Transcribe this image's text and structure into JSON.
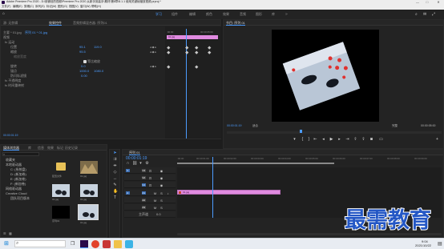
{
  "app": {
    "title": "Adobe Premiere Pro 2020 - D:\\用微信的视频\\Premiere Pro 2020 从新手到高手\\素材\\第8章\\8.1.1 使用关键帧缩放视频.prproj *"
  },
  "menu": [
    "文件(F)",
    "编辑(E)",
    "剪辑(C)",
    "序列(S)",
    "标记(M)",
    "图形(G)",
    "视图(V)",
    "窗口(W)",
    "帮助(H)"
  ],
  "workspace_tabs": [
    "学习",
    "组件",
    "编辑",
    "颜色",
    "效果",
    "音频",
    "图形",
    "库"
  ],
  "workspace_active": "学习",
  "source_panel": {
    "tabs": [
      "源: 无剪辑",
      "效果控件",
      "音频剪辑混合器: 序列01"
    ],
    "master_label": "主要 * 01.jpg",
    "clip_label": "序列 01 * 01.jpg",
    "time_in": ":00:00",
    "time_out": "00:00:05:00",
    "clip_name": "01.jpg",
    "sections": {
      "video": "视频",
      "motion": "fx 运动",
      "position": "位置",
      "position_x": "95.1",
      "position_y": "119.0",
      "scale": "缩放",
      "scale_value": "95.5",
      "scale_width": "缩放宽度",
      "uniform_scale": "等比缩放",
      "rotation": "旋转",
      "rotation_value": "0.0",
      "anchor": "锚点",
      "anchor_x": "1000.0",
      "anchor_y": "1080.0",
      "flicker": "防闪烁滤镜",
      "flicker_value": "0.00",
      "opacity": "fx 不透明度",
      "time_remap": "fx 时间重映射"
    },
    "timecode": "00:00:01:19"
  },
  "program_panel": {
    "title": "节目: 序列 01",
    "timecode": "00:00:01:19",
    "fit": "适合",
    "quality": "完整",
    "duration": "00:00:05:00"
  },
  "project_panel": {
    "tabs": [
      "项目: 使用关键帧缩放视频",
      "媒体浏览器",
      "库",
      "信息",
      "效果",
      "标记",
      "历史记录"
    ],
    "search_placeholder": "",
    "tree": [
      {
        "label": "收藏夹",
        "indent": 0
      },
      {
        "label": "本地驱动器",
        "indent": 0
      },
      {
        "label": "C: (系统盘)",
        "indent": 1
      },
      {
        "label": "D: (新加卷)",
        "indent": 1
      },
      {
        "label": "E: (新加卷)",
        "indent": 1
      },
      {
        "label": "F: (新加卷)",
        "indent": 1
      },
      {
        "label": "网络驱动器",
        "indent": 0
      },
      {
        "label": "Creative Cloud",
        "indent": 0
      },
      {
        "label": "团队项目版本",
        "indent": 1
      }
    ],
    "items": [
      {
        "label": "配置文件",
        "kind": "folder"
      },
      {
        "label": "01.jpg",
        "kind": "photo"
      },
      {
        "label": "01.jpg",
        "kind": "photo"
      },
      {
        "label": "01.jpg",
        "kind": "photo"
      },
      {
        "label": "序列01",
        "kind": "black"
      },
      {
        "label": "01.jpg",
        "kind": "photo"
      }
    ]
  },
  "timeline": {
    "title": "序列 01",
    "timecode": "00:00:01:19",
    "ruler": [
      ":00:00",
      "00:00:01:00",
      "00:00:02:00",
      "00:00:03:00",
      "00:00:04:00",
      "00:00:05:00",
      "00:00:06:00",
      "00:00:07:00",
      "00:00:08:00",
      "00:00:09:00"
    ],
    "tracks": [
      "V3",
      "V2",
      "V1",
      "A1",
      "A2",
      "A3"
    ],
    "master": "主声道",
    "master_value": "0.0",
    "clip_label": "01.jpg"
  },
  "taskbar": {
    "time": "9:04",
    "date": "2021/10/22",
    "search_placeholder": ""
  },
  "watermark": "最需教育",
  "colors": {
    "accent": "#4c9cff",
    "clip": "#e08be0",
    "playhead": "#4c9cff"
  }
}
